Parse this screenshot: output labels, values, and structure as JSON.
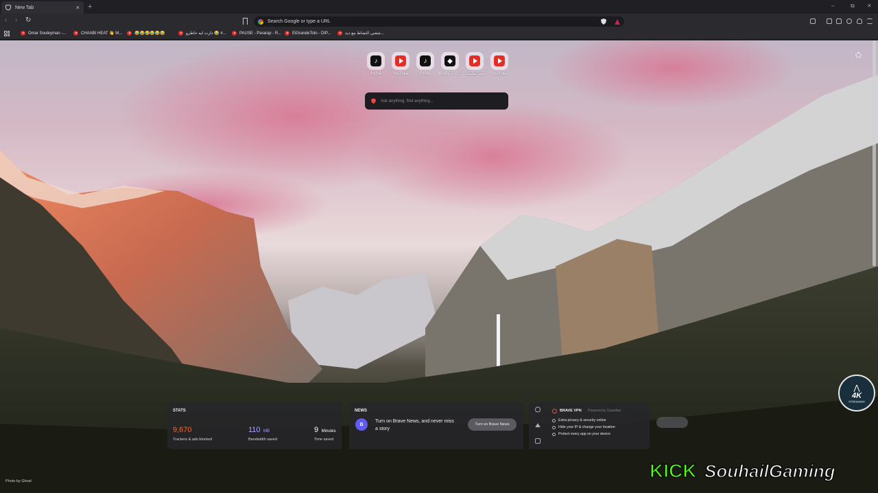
{
  "tab": {
    "title": "New Tab",
    "close": "×",
    "new_tab": "+"
  },
  "window_controls": {
    "minimize": "–",
    "restore": "⧉",
    "close": "✕"
  },
  "toolbar": {
    "back": "‹",
    "forward": "›",
    "reload": "↻",
    "omnibox_placeholder": "Search Google or type a URL"
  },
  "bookmarks": [
    {
      "label": "Omar Souleyman -..."
    },
    {
      "label": "CHAABI HEAT 👋 M..."
    },
    {
      "label": "😂😂😂😂😂😂"
    },
    {
      "label": "دارت ليه خاطرو 😂 #..."
    },
    {
      "label": "PAUSE - Pararap - R..."
    },
    {
      "label": "ElGrandeToto - DIP..."
    },
    {
      "label": "شعبي النشاط مع ديد..."
    }
  ],
  "shortcuts": [
    {
      "label": "TikTok",
      "icon": "tiktok-icon"
    },
    {
      "label": "YouTube",
      "icon": "youtube-icon"
    },
    {
      "label": "TikTok",
      "icon": "tiktok-icon"
    },
    {
      "label": "BotRix — C...",
      "icon": "botrix-icon"
    },
    {
      "label": "عمر سليمان",
      "icon": "youtube-icon"
    },
    {
      "label": "YouTube",
      "icon": "youtube-icon"
    }
  ],
  "search": {
    "placeholder": "Ask anything, find anything..."
  },
  "photo_credit": "Photo by Ghost",
  "stats": {
    "title": "STATS",
    "trackers": {
      "value": "9,670",
      "caption": "Trackers & ads blocked",
      "color": "#f06a35"
    },
    "bandwidth": {
      "value": "110",
      "unit": "MB",
      "caption": "Bandwidth saved",
      "color": "#a9a4ff"
    },
    "time": {
      "value": "9",
      "unit": "Minutes",
      "caption": "Time saved",
      "color": "#ffffff"
    }
  },
  "news": {
    "title": "NEWS",
    "icon_letter": "B",
    "text": "Turn on Brave News, and never miss a story",
    "button": "Turn on Brave News"
  },
  "vpn": {
    "title": "BRAVE VPN",
    "powered": "Powered by  Guardian",
    "features": [
      "Extra privacy & security online",
      "Hide your IP & change your location",
      "Protect every app on your device"
    ]
  },
  "overlays": {
    "badge_big": "4K",
    "badge_small": "STREAMING",
    "kick_brand": "KICK",
    "kick_channel": "SouhailGaming"
  },
  "colors": {
    "accent_brave": "#f0453a",
    "kick_green": "#53fc18"
  }
}
